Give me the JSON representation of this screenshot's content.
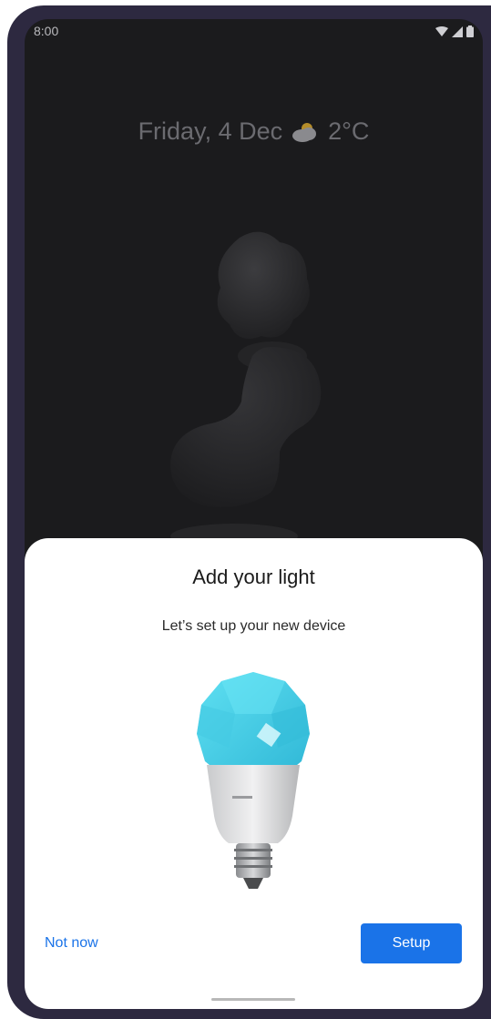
{
  "status_bar": {
    "time": "8:00",
    "icons": [
      "wifi-icon",
      "cell-signal-icon",
      "battery-icon"
    ]
  },
  "lockscreen": {
    "date": "Friday, 4 Dec",
    "weather_icon": "partly-cloudy-icon",
    "temperature": "2°C"
  },
  "sheet": {
    "title": "Add your light",
    "subtitle": "Let’s set up your new device",
    "device_image": "smart-light-bulb",
    "secondary_button": "Not now",
    "primary_button": "Setup"
  },
  "colors": {
    "accent": "#1a73e8",
    "frame": "#2d2940",
    "screen_bg": "#1b1b1d",
    "bulb_glow": "#47d2ea"
  }
}
